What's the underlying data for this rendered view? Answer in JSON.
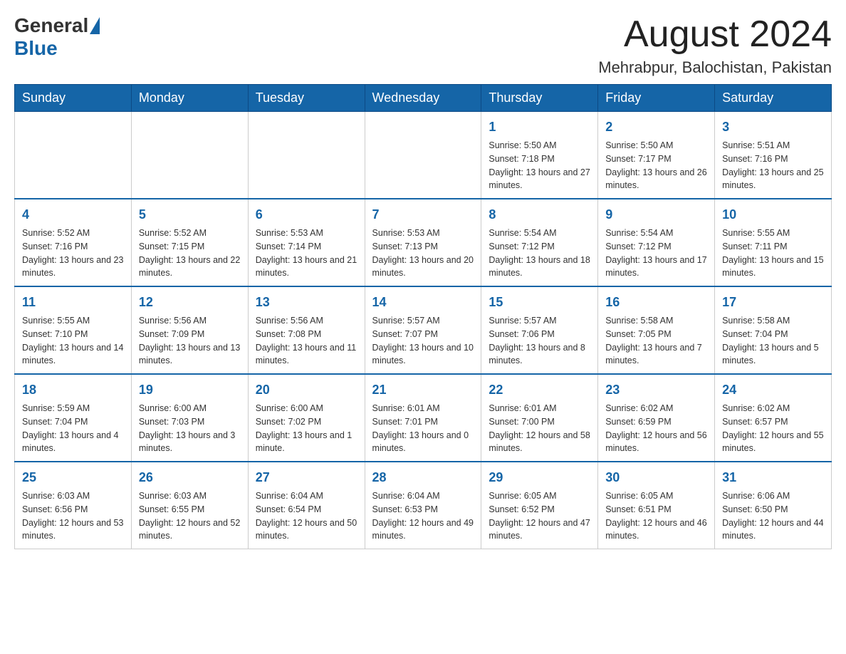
{
  "logo": {
    "general": "General",
    "blue": "Blue"
  },
  "header": {
    "title": "August 2024",
    "location": "Mehrabpur, Balochistan, Pakistan"
  },
  "weekdays": [
    "Sunday",
    "Monday",
    "Tuesday",
    "Wednesday",
    "Thursday",
    "Friday",
    "Saturday"
  ],
  "weeks": [
    [
      {
        "day": "",
        "info": ""
      },
      {
        "day": "",
        "info": ""
      },
      {
        "day": "",
        "info": ""
      },
      {
        "day": "",
        "info": ""
      },
      {
        "day": "1",
        "info": "Sunrise: 5:50 AM\nSunset: 7:18 PM\nDaylight: 13 hours and 27 minutes."
      },
      {
        "day": "2",
        "info": "Sunrise: 5:50 AM\nSunset: 7:17 PM\nDaylight: 13 hours and 26 minutes."
      },
      {
        "day": "3",
        "info": "Sunrise: 5:51 AM\nSunset: 7:16 PM\nDaylight: 13 hours and 25 minutes."
      }
    ],
    [
      {
        "day": "4",
        "info": "Sunrise: 5:52 AM\nSunset: 7:16 PM\nDaylight: 13 hours and 23 minutes."
      },
      {
        "day": "5",
        "info": "Sunrise: 5:52 AM\nSunset: 7:15 PM\nDaylight: 13 hours and 22 minutes."
      },
      {
        "day": "6",
        "info": "Sunrise: 5:53 AM\nSunset: 7:14 PM\nDaylight: 13 hours and 21 minutes."
      },
      {
        "day": "7",
        "info": "Sunrise: 5:53 AM\nSunset: 7:13 PM\nDaylight: 13 hours and 20 minutes."
      },
      {
        "day": "8",
        "info": "Sunrise: 5:54 AM\nSunset: 7:12 PM\nDaylight: 13 hours and 18 minutes."
      },
      {
        "day": "9",
        "info": "Sunrise: 5:54 AM\nSunset: 7:12 PM\nDaylight: 13 hours and 17 minutes."
      },
      {
        "day": "10",
        "info": "Sunrise: 5:55 AM\nSunset: 7:11 PM\nDaylight: 13 hours and 15 minutes."
      }
    ],
    [
      {
        "day": "11",
        "info": "Sunrise: 5:55 AM\nSunset: 7:10 PM\nDaylight: 13 hours and 14 minutes."
      },
      {
        "day": "12",
        "info": "Sunrise: 5:56 AM\nSunset: 7:09 PM\nDaylight: 13 hours and 13 minutes."
      },
      {
        "day": "13",
        "info": "Sunrise: 5:56 AM\nSunset: 7:08 PM\nDaylight: 13 hours and 11 minutes."
      },
      {
        "day": "14",
        "info": "Sunrise: 5:57 AM\nSunset: 7:07 PM\nDaylight: 13 hours and 10 minutes."
      },
      {
        "day": "15",
        "info": "Sunrise: 5:57 AM\nSunset: 7:06 PM\nDaylight: 13 hours and 8 minutes."
      },
      {
        "day": "16",
        "info": "Sunrise: 5:58 AM\nSunset: 7:05 PM\nDaylight: 13 hours and 7 minutes."
      },
      {
        "day": "17",
        "info": "Sunrise: 5:58 AM\nSunset: 7:04 PM\nDaylight: 13 hours and 5 minutes."
      }
    ],
    [
      {
        "day": "18",
        "info": "Sunrise: 5:59 AM\nSunset: 7:04 PM\nDaylight: 13 hours and 4 minutes."
      },
      {
        "day": "19",
        "info": "Sunrise: 6:00 AM\nSunset: 7:03 PM\nDaylight: 13 hours and 3 minutes."
      },
      {
        "day": "20",
        "info": "Sunrise: 6:00 AM\nSunset: 7:02 PM\nDaylight: 13 hours and 1 minute."
      },
      {
        "day": "21",
        "info": "Sunrise: 6:01 AM\nSunset: 7:01 PM\nDaylight: 13 hours and 0 minutes."
      },
      {
        "day": "22",
        "info": "Sunrise: 6:01 AM\nSunset: 7:00 PM\nDaylight: 12 hours and 58 minutes."
      },
      {
        "day": "23",
        "info": "Sunrise: 6:02 AM\nSunset: 6:59 PM\nDaylight: 12 hours and 56 minutes."
      },
      {
        "day": "24",
        "info": "Sunrise: 6:02 AM\nSunset: 6:57 PM\nDaylight: 12 hours and 55 minutes."
      }
    ],
    [
      {
        "day": "25",
        "info": "Sunrise: 6:03 AM\nSunset: 6:56 PM\nDaylight: 12 hours and 53 minutes."
      },
      {
        "day": "26",
        "info": "Sunrise: 6:03 AM\nSunset: 6:55 PM\nDaylight: 12 hours and 52 minutes."
      },
      {
        "day": "27",
        "info": "Sunrise: 6:04 AM\nSunset: 6:54 PM\nDaylight: 12 hours and 50 minutes."
      },
      {
        "day": "28",
        "info": "Sunrise: 6:04 AM\nSunset: 6:53 PM\nDaylight: 12 hours and 49 minutes."
      },
      {
        "day": "29",
        "info": "Sunrise: 6:05 AM\nSunset: 6:52 PM\nDaylight: 12 hours and 47 minutes."
      },
      {
        "day": "30",
        "info": "Sunrise: 6:05 AM\nSunset: 6:51 PM\nDaylight: 12 hours and 46 minutes."
      },
      {
        "day": "31",
        "info": "Sunrise: 6:06 AM\nSunset: 6:50 PM\nDaylight: 12 hours and 44 minutes."
      }
    ]
  ]
}
